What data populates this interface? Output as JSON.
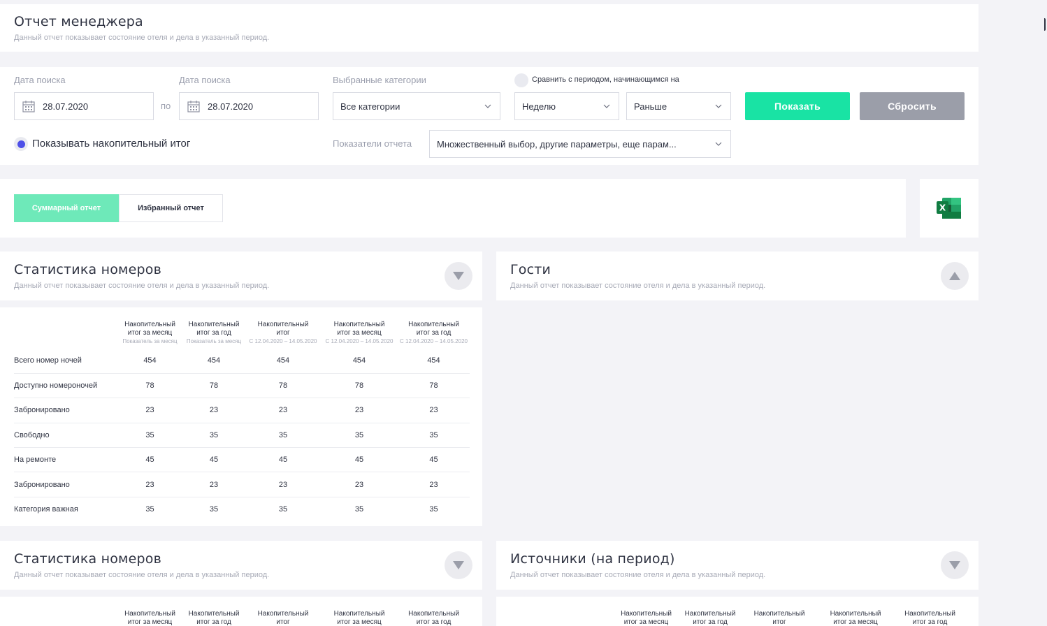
{
  "header": {
    "title": "Отчет менеджера",
    "subtitle": "Данный отчет показывает состояние отеля и дела в указанный период."
  },
  "filters": {
    "date_from_label": "Дата поиска",
    "date_from_value": "28.07.2020",
    "between_label": "по",
    "date_to_label": "Дата поиска",
    "date_to_value": "28.07.2020",
    "categories_label": "Выбранные категории",
    "categories_value": "Все категории",
    "compare_label": "Сравнить с периодом, начинающимся на",
    "period_value": "Неделю",
    "direction_value": "Раньше",
    "show_button": "Показать",
    "reset_button": "Сбросить",
    "cumulative_label": "Показывать накопительный итог",
    "indicators_label": "Показатели отчета",
    "indicators_value": "Множественный выбор, другие параметры, еще парам..."
  },
  "tabs": {
    "summary": "Суммарный отчет",
    "favorites": "Избранный отчет"
  },
  "colors": {
    "accent": "#19e3a4",
    "tab_active": "#6ee9b9",
    "reset": "#9b9ea9",
    "radio": "#4e50e8"
  },
  "icons": {
    "excel": "excel-icon",
    "calendar": "calendar-icon",
    "chevron": "chevron-down-icon"
  },
  "panels": {
    "rooms": {
      "title": "Статистика номеров",
      "subtitle": "Данный отчет показывает состояние отеля и дела в указанный период."
    },
    "guests": {
      "title": "Гости",
      "subtitle": "Данный отчет показывает состояние отеля и дела в указанный период."
    },
    "rooms2": {
      "title": "Статистика номеров",
      "subtitle": "Данный отчет показывает состояние отеля и дела в указанный период."
    },
    "sources": {
      "title": "Источники (на период)",
      "subtitle": "Данный отчет показывает состояние отеля и дела в указанный период."
    }
  },
  "table": {
    "columns": [
      {
        "line1": "Накопительный",
        "line2": "итог за месяц",
        "note": "Показатель за месяц"
      },
      {
        "line1": "Накопительный",
        "line2": "итог за год",
        "note": "Показатель за месяц"
      },
      {
        "line1": "Накопительный",
        "line2": "итог",
        "note": "С 12.04.2020 – 14.05.2020"
      },
      {
        "line1": "Накопительный",
        "line2": "итог за месяц",
        "note": "С 12.04.2020 – 14.05.2020"
      },
      {
        "line1": "Накопительный",
        "line2": "итог за год",
        "note": "С 12.04.2020 – 14.05.2020"
      }
    ],
    "rows": [
      {
        "label": "Всего номер ночей",
        "values": [
          "454",
          "454",
          "454",
          "454",
          "454"
        ]
      },
      {
        "label": "Доступно номероночей",
        "values": [
          "78",
          "78",
          "78",
          "78",
          "78"
        ]
      },
      {
        "label": "Забронировано",
        "values": [
          "23",
          "23",
          "23",
          "23",
          "23"
        ]
      },
      {
        "label": "Свободно",
        "values": [
          "35",
          "35",
          "35",
          "35",
          "35"
        ]
      },
      {
        "label": "На ремонте",
        "values": [
          "45",
          "45",
          "45",
          "45",
          "45"
        ]
      },
      {
        "label": "Забронировано",
        "values": [
          "23",
          "23",
          "23",
          "23",
          "23"
        ]
      },
      {
        "label": "Категория важная",
        "values": [
          "35",
          "35",
          "35",
          "35",
          "35"
        ]
      }
    ]
  }
}
